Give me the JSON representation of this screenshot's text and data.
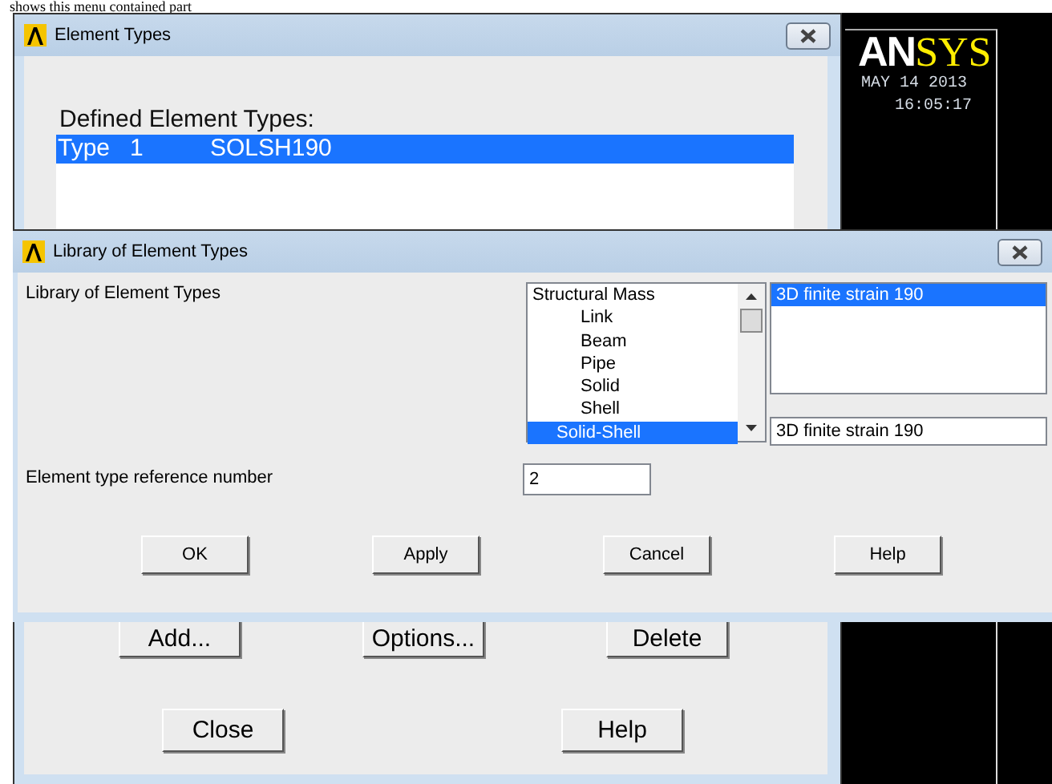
{
  "document_text": "shows this menu contained part",
  "element_types_window": {
    "title": "Element Types",
    "list_label": "Defined Element Types:",
    "rows": [
      {
        "type_label": "Type",
        "number": "1",
        "name": "SOLSH190",
        "selected": true
      }
    ],
    "buttons_row1": [
      "Add...",
      "Options...",
      "Delete"
    ],
    "buttons_row2": [
      "Close",
      "Help"
    ]
  },
  "graphics": {
    "logo_left": "AN",
    "logo_right": "SYS",
    "date": "MAY 14 2013",
    "time": "16:05:17"
  },
  "library_dialog": {
    "title": "Library of Element Types",
    "label": "Library of Element Types",
    "category_list": [
      {
        "label": "Structural Mass",
        "kind": "top",
        "selected": false
      },
      {
        "label": "Link",
        "kind": "sub",
        "selected": false
      },
      {
        "label": "Beam",
        "kind": "sub",
        "selected": false
      },
      {
        "label": "Pipe",
        "kind": "sub",
        "selected": false
      },
      {
        "label": "Solid",
        "kind": "sub",
        "selected": false
      },
      {
        "label": "Shell",
        "kind": "sub",
        "selected": false
      },
      {
        "label": "Solid-Shell",
        "kind": "mid",
        "selected": true
      }
    ],
    "element_list": [
      {
        "label": "3D finite strain 190",
        "selected": true
      }
    ],
    "element_field": "3D finite strain 190",
    "ref_label": "Element type reference number",
    "ref_value": "2",
    "buttons": [
      "OK",
      "Apply",
      "Cancel",
      "Help"
    ]
  }
}
